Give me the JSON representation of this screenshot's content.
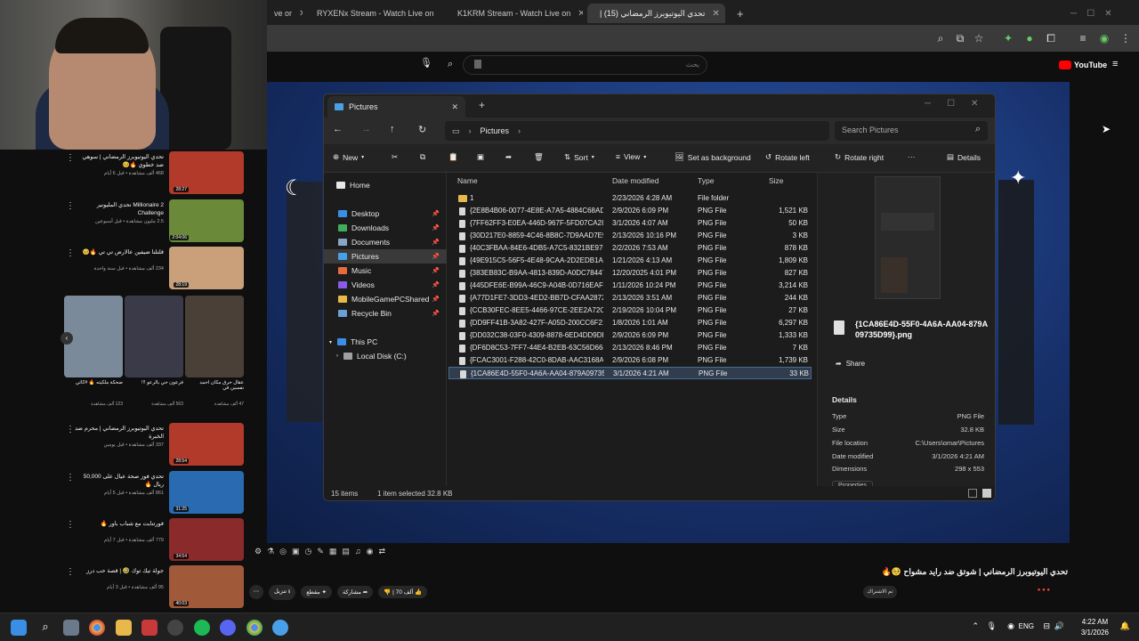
{
  "browser": {
    "tabs": [
      {
        "label": "ve or",
        "icon": "ghost-tab-icon"
      },
      {
        "label": "RYXENx Stream - Watch Live on",
        "icon": "kick-icon"
      },
      {
        "label": "K1KRM Stream - Watch Live on",
        "icon": "kick-icon"
      },
      {
        "label": "تحدي اليوتيوبرز الرمضاني (15) |",
        "icon": "youtube-icon"
      }
    ],
    "new_tab": "+"
  },
  "youtube": {
    "logo": "YouTube",
    "search_placeholder": "بحث",
    "video_title": "تحدي اليوتيوبرز الرمضاني | شوتق ضد رايد مشواح 🥺🔥",
    "channel_sub": "تم الاشتراك",
    "likes": "70 ألف",
    "share": "مشاركة",
    "save": "حفظ",
    "download": "تنزيل",
    "clip": "مقطع"
  },
  "recommendations": [
    {
      "title": "تحدي اليوتيوبرز الرمضاني | سوهي ضد خطوي 🔥🥺",
      "meta": "468 ألف مشاهدة • قبل 6 أيام",
      "duration": "28:27",
      "thumb": "#b23a2a"
    },
    {
      "title": "Millionaire 2 تحدي المليونير Challenge",
      "meta": "2.5 مليون مشاهدة • قبل أسبوعين",
      "duration": "2:04:06",
      "thumb": "#6a8a3a"
    },
    {
      "title": "قلتلنا ضيفين عالارض تي تي 🔥🥺",
      "meta": "234 ألف مشاهدة • قبل سنة واحدة",
      "duration": "28:19",
      "thumb": "#c9a07a"
    },
    {
      "title": "تحدي اليوتيوبرز الرمضاني | محرم ضد الخبرة",
      "meta": "337 ألف مشاهدة • قبل يومين",
      "duration": "28:54",
      "thumb": "#b23a2a"
    },
    {
      "title": "تحدي فوز صحة عيال على 50,000 ريال 🔥",
      "meta": "861 ألف مشاهدة • قبل 5 أيام",
      "duration": "31:25",
      "thumb": "#2a6ab0"
    },
    {
      "title": "فورتنايت مع شباب باور 🔥",
      "meta": "779 ألف مشاهدة • قبل 7 أيام",
      "duration": "34:54",
      "thumb": "#8a2a2a"
    },
    {
      "title": "جولة تيك توك 🤣 | قصة حب درز",
      "meta": "95 ألف مشاهدة • قبل 3 أيام",
      "duration": "40:03",
      "thumb": "#a05a3a"
    }
  ],
  "shorts": [
    {
      "title": "ضحكة ملكيته 🔥 #كاثي",
      "meta": "123 ألف مشاهدة"
    },
    {
      "title": "فرعون حي بالرعو !!!",
      "meta": "563 ألف مشاهدة"
    },
    {
      "title": "عقال حرق مكان احمد نفسين في",
      "meta": "47 ألف مشاهدة"
    }
  ],
  "explorer": {
    "tab_title": "Pictures",
    "breadcrumb": "Pictures",
    "search_placeholder": "Search Pictures",
    "commands": {
      "new": "New",
      "sort": "Sort",
      "view": "View",
      "set_bg": "Set as background",
      "rotate_left": "Rotate left",
      "rotate_right": "Rotate right",
      "more": "···",
      "details": "Details"
    },
    "nav": [
      {
        "label": "Home",
        "icon": "home-icon",
        "color": "#e8e8e8",
        "pinned": false
      },
      {
        "label": "Desktop",
        "icon": "desktop-icon",
        "color": "#3a8ee6",
        "pinned": true
      },
      {
        "label": "Downloads",
        "icon": "downloads-icon",
        "color": "#3fae5a",
        "pinned": true
      },
      {
        "label": "Documents",
        "icon": "documents-icon",
        "color": "#8aa4c8",
        "pinned": true
      },
      {
        "label": "Pictures",
        "icon": "pictures-icon",
        "color": "#4aa0e8",
        "pinned": true,
        "selected": true
      },
      {
        "label": "Music",
        "icon": "music-icon",
        "color": "#e86a3a",
        "pinned": true
      },
      {
        "label": "Videos",
        "icon": "videos-icon",
        "color": "#8a5ae8",
        "pinned": true
      },
      {
        "label": "MobileGamePCShared",
        "icon": "folder-icon",
        "color": "#e8b84a",
        "pinned": true
      },
      {
        "label": "Recycle Bin",
        "icon": "recycle-bin-icon",
        "color": "#6aa0d8",
        "pinned": true
      },
      {
        "label": "This PC",
        "icon": "pc-icon",
        "color": "#3a8ee6",
        "pinned": false
      },
      {
        "label": "Local Disk (C:)",
        "icon": "disk-icon",
        "color": "#a0a0a0",
        "pinned": false
      }
    ],
    "columns": [
      "Name",
      "Date modified",
      "Type",
      "Size"
    ],
    "files": [
      {
        "name": "1",
        "date": "2/23/2026 4:28 AM",
        "type": "File folder",
        "size": "",
        "folder": true
      },
      {
        "name": "{2E8B4B06-0077-4E8E-A7A5-4884C68AD8...",
        "date": "2/9/2026 6:09 PM",
        "type": "PNG File",
        "size": "1,521 KB"
      },
      {
        "name": "{7FF62FF3-E0EA-446D-967F-5FD07CA28C...",
        "date": "3/1/2026 4:07 AM",
        "type": "PNG File",
        "size": "50 KB"
      },
      {
        "name": "{30D217E0-8859-4C46-8B8C-7D9AAD7E9...",
        "date": "2/13/2026 10:16 PM",
        "type": "PNG File",
        "size": "3 KB"
      },
      {
        "name": "{40C3FBAA-84E6-4DB5-A7C5-8321BE97C...",
        "date": "2/2/2026 7:53 AM",
        "type": "PNG File",
        "size": "878 KB"
      },
      {
        "name": "{49E915C5-56F5-4E48-9CAA-2D2EDB1AD...",
        "date": "1/21/2026 4:13 AM",
        "type": "PNG File",
        "size": "1,809 KB"
      },
      {
        "name": "{383EB83C-B9AA-4813-839D-A0DC78447...",
        "date": "12/20/2025 4:01 PM",
        "type": "PNG File",
        "size": "827 KB"
      },
      {
        "name": "{445DFE6E-B99A-46C9-A04B-0D716EAFB...",
        "date": "1/11/2026 10:24 PM",
        "type": "PNG File",
        "size": "3,214 KB"
      },
      {
        "name": "{A77D1FE7-3DD3-4ED2-BB7D-CFAA2872E...",
        "date": "2/13/2026 3:51 AM",
        "type": "PNG File",
        "size": "244 KB"
      },
      {
        "name": "{CCB30FEC-8EE5-4466-97CE-2EE2A72C82...",
        "date": "2/19/2026 10:04 PM",
        "type": "PNG File",
        "size": "27 KB"
      },
      {
        "name": "{DD9FF41B-3A82-427F-A05D-200CC6F21...",
        "date": "1/8/2026 1:01 AM",
        "type": "PNG File",
        "size": "6,297 KB"
      },
      {
        "name": "{DD032C38-03F0-4309-8878-6ED4DD9DB...",
        "date": "2/9/2026 6:09 PM",
        "type": "PNG File",
        "size": "1,333 KB"
      },
      {
        "name": "{DF6D8C53-7FF7-44E4-B2EB-63C56D6647...",
        "date": "2/13/2026 8:46 PM",
        "type": "PNG File",
        "size": "7 KB"
      },
      {
        "name": "{FCAC3001-F288-42C0-8DAB-AAC3168A...",
        "date": "2/9/2026 6:08 PM",
        "type": "PNG File",
        "size": "1,739 KB"
      },
      {
        "name": "{1CA86E4D-55F0-4A6A-AA04-879A09735...",
        "date": "3/1/2026 4:21 AM",
        "type": "PNG File",
        "size": "33 KB",
        "selected": true
      }
    ],
    "preview": {
      "filename": "{1CA86E4D-55F0-4A6A-AA04-879A09735D99}.png",
      "share": "Share",
      "details_heading": "Details",
      "details": [
        {
          "k": "Type",
          "v": "PNG File"
        },
        {
          "k": "Size",
          "v": "32.8 KB"
        },
        {
          "k": "File location",
          "v": "C:\\Users\\omar\\Pictures"
        },
        {
          "k": "Date modified",
          "v": "3/1/2026 4:21 AM"
        },
        {
          "k": "Dimensions",
          "v": "298 x 553"
        }
      ],
      "properties": "Properties"
    },
    "status": {
      "items": "15 items",
      "selected": "1 item selected  32.8 KB"
    }
  },
  "taskbar": {
    "lang": "ENG",
    "time": "4:22 AM",
    "date": "3/1/2026"
  }
}
